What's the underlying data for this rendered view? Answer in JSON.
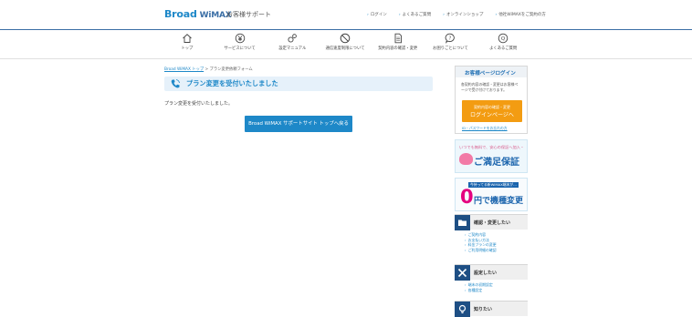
{
  "header": {
    "logo_main": "Broad",
    "logo_wimax": "WiMAX",
    "logo_sub": "お客様サポート",
    "links": [
      "ログイン",
      "よくあるご質問",
      "オンラインショップ",
      "他社WiMAXをご契約の方"
    ]
  },
  "gnav": {
    "items": [
      {
        "label": "トップ",
        "icon": "home-icon"
      },
      {
        "label": "サービスについて",
        "icon": "yen-icon"
      },
      {
        "label": "設定マニュアル",
        "icon": "gears-icon"
      },
      {
        "label": "通信速度制限について",
        "icon": "restriction-icon"
      },
      {
        "label": "契約内容の確認・変更",
        "icon": "document-icon"
      },
      {
        "label": "お困りごとについて",
        "icon": "question-icon"
      },
      {
        "label": "よくあるご質問",
        "icon": "qa-icon"
      }
    ]
  },
  "breadcrumb": {
    "home": "Broad WiMAX トップ",
    "sep": ">",
    "current": "プラン変更依頼フォーム"
  },
  "main": {
    "title": "プラン変更を受付いたしました",
    "message": "プラン変更を受付いたしました。",
    "back_button": "Broad WiMAX サポートサイト トップへ戻る"
  },
  "sidebar": {
    "login": {
      "heading": "お客様ページログイン",
      "desc": "各契約内容の確認・変更はお客様ページで受け付けております。",
      "button_line1": "契約内容の確認・変更",
      "button_line2": "ログインページへ",
      "link": "ID・パスワードをお忘れの方"
    },
    "banner1": {
      "small": "いつでも無料で、安心の保証へ加入・",
      "big": "ご満足保証"
    },
    "banner2": {
      "small": "今持ってる新WiMAX端末が…",
      "zero": "0",
      "big": "円で機種変更"
    },
    "sections": [
      {
        "title": "確認・変更したい",
        "icon": "folder-icon",
        "items": [
          "ご契約内容",
          "お支払い方法",
          "料金プランの変更",
          "ご利用明細の確認"
        ]
      },
      {
        "title": "設定したい",
        "icon": "tools-icon",
        "items": [
          "端末の初期設定",
          "各種設定"
        ]
      },
      {
        "title": "知りたい",
        "icon": "bulb-icon",
        "items": []
      }
    ]
  },
  "colors": {
    "brand": "#1e88c8",
    "navy": "#1e4f84",
    "orange": "#f39c12",
    "pink": "#e4007f"
  }
}
